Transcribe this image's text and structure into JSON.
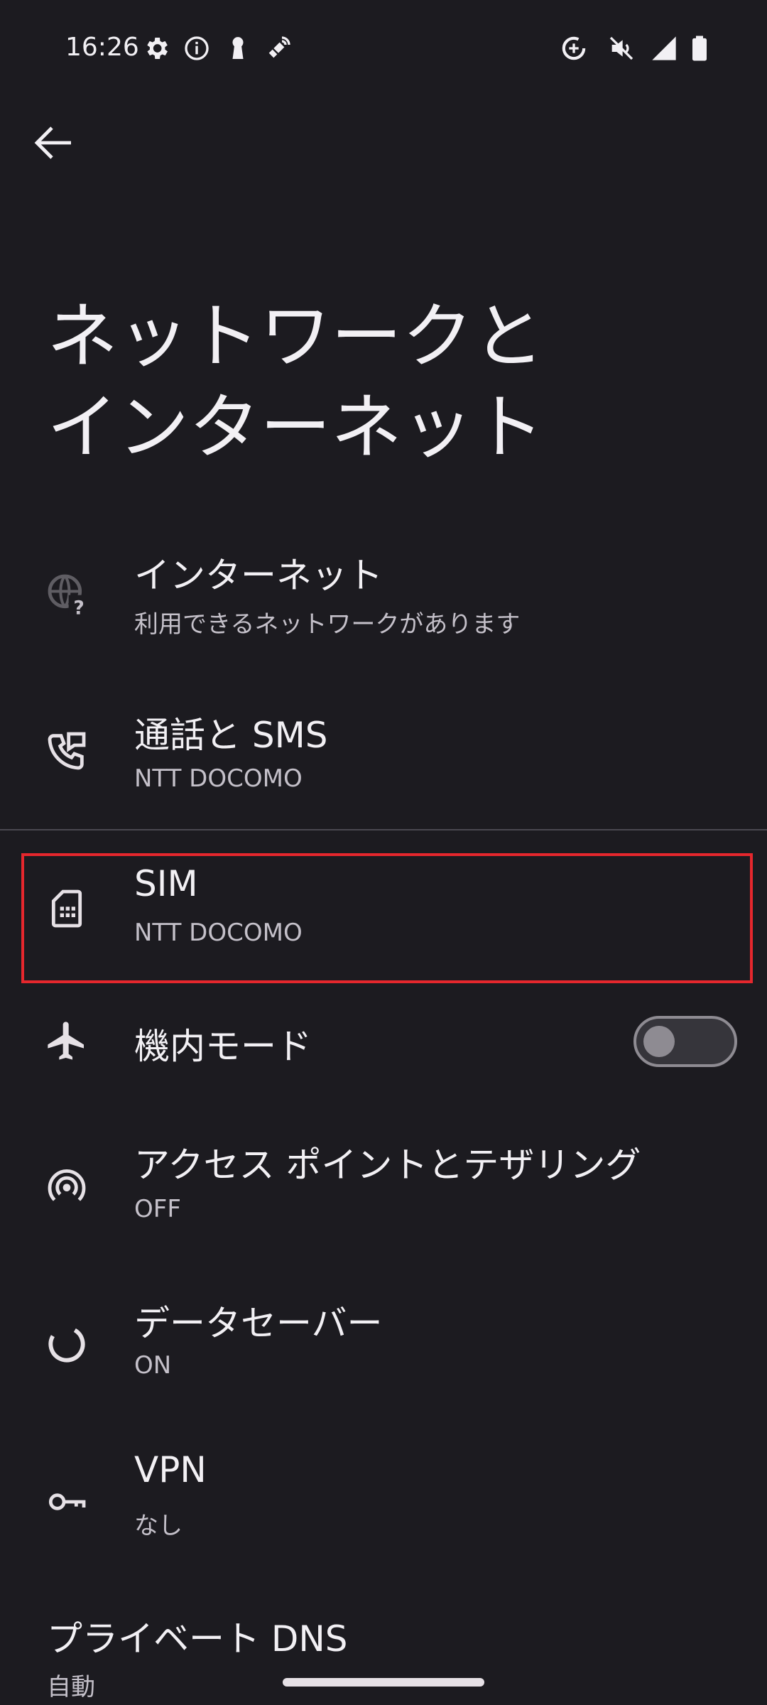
{
  "status_bar": {
    "time": "16:26",
    "left_icons": [
      "gear-icon",
      "info-icon",
      "keyhole-icon",
      "satellite-icon"
    ],
    "right_icons": [
      "data-saver-icon",
      "vibrate-off-icon",
      "signal-icon",
      "battery-icon"
    ]
  },
  "header": {
    "title": "ネットワークと\nインターネット"
  },
  "items": [
    {
      "title": "インターネット",
      "subtitle": "利用できるネットワークがあります",
      "icon": "globe-question-icon"
    },
    {
      "title": "通話と SMS",
      "subtitle": "NTT DOCOMO",
      "icon": "phone-message-icon"
    },
    {
      "title": "SIM",
      "subtitle": "NTT DOCOMO",
      "icon": "sim-card-icon"
    },
    {
      "title": "機内モード",
      "subtitle": "",
      "icon": "airplane-icon",
      "toggle": false
    },
    {
      "title": "アクセス ポイントとテザリング",
      "subtitle": "OFF",
      "icon": "hotspot-icon"
    },
    {
      "title": "データセーバー",
      "subtitle": "ON",
      "icon": "data-saver-icon"
    },
    {
      "title": "VPN",
      "subtitle": "なし",
      "icon": "key-icon"
    },
    {
      "title": "プライベート DNS",
      "subtitle": "自動"
    }
  ],
  "colors": {
    "background": "#1c1b20",
    "highlight": "#e5272d",
    "text_primary": "#f2f0f4",
    "text_secondary": "#c4c0c9"
  }
}
